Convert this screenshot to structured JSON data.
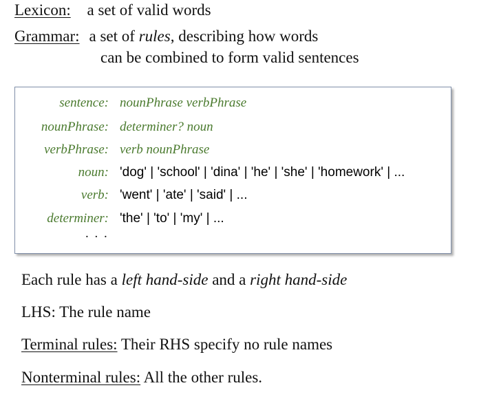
{
  "definitions": [
    {
      "term": "Lexicon:",
      "text": "a set of valid words"
    },
    {
      "term": "Grammar:",
      "text_before": "a set of ",
      "text_italic": "rules",
      "text_after": ", describing how words",
      "continuation": "can be combined to form valid sentences"
    }
  ],
  "rules": [
    {
      "name": "sentence:",
      "body": "nounPhrase  verbPhrase",
      "kind": "nonterminal"
    },
    {
      "name": "nounPhrase:",
      "body": "determiner?  noun",
      "kind": "nonterminal"
    },
    {
      "name": "verbPhrase:",
      "body": "verb  nounPhrase",
      "kind": "nonterminal"
    },
    {
      "name": "noun:",
      "body": "'dog' | 'school' | 'dina' | 'he' | 'she' | 'homework' | ...",
      "kind": "terminal"
    },
    {
      "name": "verb:",
      "body": "'went' | 'ate' | 'said' | ...",
      "kind": "terminal"
    },
    {
      "name": "determiner:",
      "body": "'the' | 'to' | 'my' | ...",
      "kind": "terminal"
    }
  ],
  "rules_ellipsis": ". . .",
  "notes": {
    "sides": {
      "prefix": "Each rule has a ",
      "lhs": "left hand-side",
      "middle": " and a ",
      "rhs": "right hand-side"
    },
    "lhs": "LHS: The rule name",
    "terminal": {
      "term": "Terminal rules:",
      "text": " Their RHS specify no rule names"
    },
    "nonterminal": {
      "term": "Nonterminal rules:",
      "text": " All the other rules."
    }
  },
  "colors": {
    "nonterminal_green": "#4a7a2e",
    "box_border": "#7f8ea8",
    "text": "#111111"
  }
}
